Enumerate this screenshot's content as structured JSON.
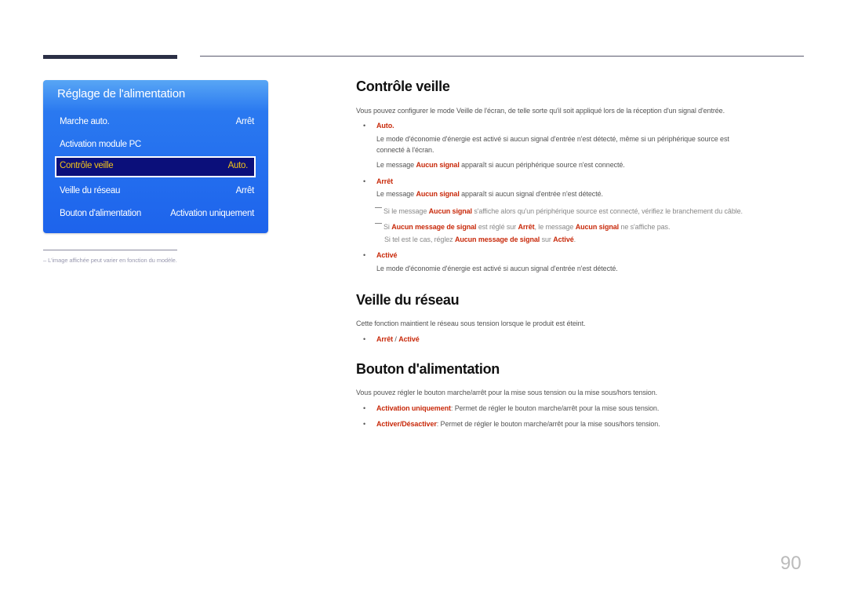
{
  "panel": {
    "title": "Réglage de l'alimentation",
    "items": [
      {
        "label": "Marche auto.",
        "value": "Arrêt"
      },
      {
        "label": "Activation module PC",
        "value": ""
      },
      {
        "label": "Contrôle veille",
        "value": "Auto.",
        "selected": true
      },
      {
        "label": "Veille du réseau",
        "value": "Arrêt"
      },
      {
        "label": "Bouton d'alimentation",
        "value": "Activation uniquement"
      }
    ]
  },
  "footnote": "L'image affichée peut varier en fonction du modèle.",
  "footnote_dash": "–",
  "sections": {
    "controle_veille": {
      "title": "Contrôle veille",
      "intro": "Vous pouvez configurer le mode Veille de l'écran, de telle sorte qu'il soit appliqué lors de la réception d'un signal d'entrée.",
      "auto": {
        "label": "Auto.",
        "desc1_line1": "Le mode d'économie d'énergie est activé si aucun signal d'entrée n'est détecté, même si un périphérique source est",
        "desc1_line2": "connecté à l'écran.",
        "desc2_pre": "Le message ",
        "desc2_hl": "Aucun signal",
        "desc2_post": " apparaît si aucun périphérique source n'est connecté."
      },
      "arret": {
        "label": "Arrêt",
        "desc_pre": "Le message ",
        "desc_hl": "Aucun signal",
        "desc_post": " apparaît si aucun signal d'entrée n'est détecté."
      },
      "note1": {
        "pre": "Si le message ",
        "hl": "Aucun signal",
        "post": " s'affiche alors qu'un périphérique source est connecté, vérifiez le branchement du câble."
      },
      "note2": {
        "pre": "Si ",
        "hl1": "Aucun message de signal",
        "mid1": " est réglé sur ",
        "hl2": "Arrêt",
        "mid2": ", le message ",
        "hl3": "Aucun signal",
        "post": " ne s'affiche pas."
      },
      "note3": {
        "pre": "Si tel est le cas, réglez ",
        "hl1": "Aucun message de signal",
        "mid": " sur ",
        "hl2": "Activé",
        "post": "."
      },
      "active": {
        "label": "Activé",
        "desc": "Le mode d'économie d'énergie est activé si aucun signal d'entrée n'est détecté."
      }
    },
    "veille_reseau": {
      "title": "Veille du réseau",
      "intro": "Cette fonction maintient le réseau sous tension lorsque le produit est éteint.",
      "opt1": "Arrêt",
      "sep": " / ",
      "opt2": "Activé"
    },
    "bouton_alimentation": {
      "title": "Bouton d'alimentation",
      "intro": "Vous pouvez régler le bouton marche/arrêt pour la mise sous tension ou la mise sous/hors tension.",
      "opt1_label": "Activation uniquement",
      "opt1_desc": ": Permet de régler le bouton marche/arrêt pour la mise sous tension.",
      "opt2_label": "Activer/Désactiver",
      "opt2_desc": ": Permet de régler le bouton marche/arrêt pour la mise sous/hors tension."
    }
  },
  "bullet_char": "•",
  "page_number": "90",
  "colors": {
    "accent": "#c8290a",
    "panel_blue": "#1d63ec",
    "selected_bg": "#0b0f7a",
    "selected_text": "#f2c31a"
  }
}
